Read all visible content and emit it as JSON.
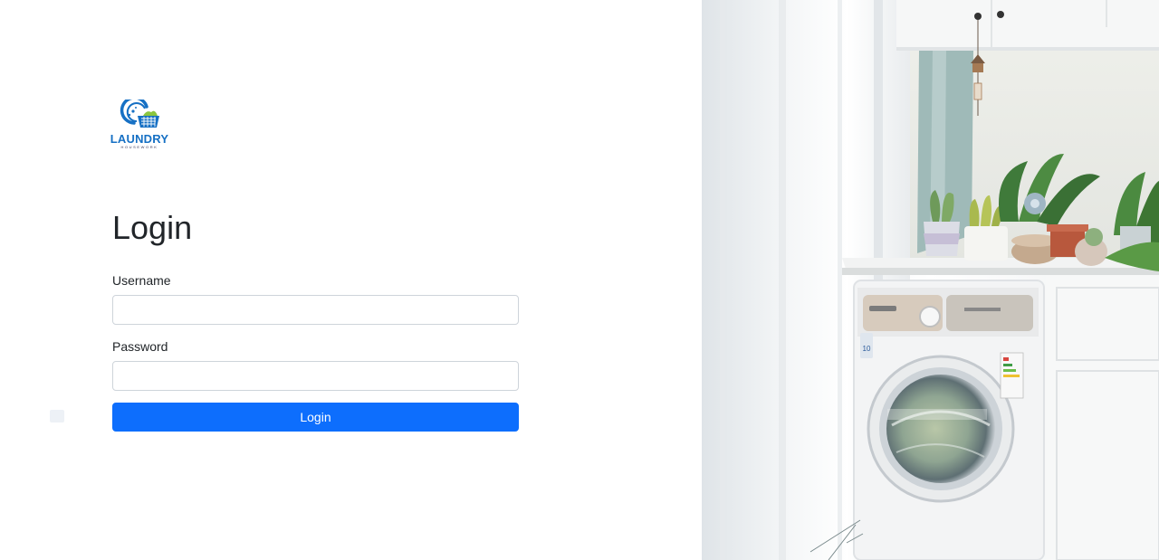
{
  "brand": {
    "name": "LAUNDRY",
    "tagline": "HOUSEWORK",
    "primary_color": "#1670c4",
    "accent_color": "#8cc63f"
  },
  "form": {
    "title": "Login",
    "username_label": "Username",
    "username_value": "",
    "password_label": "Password",
    "password_value": "",
    "submit_label": "Login",
    "button_color": "#0d6efd"
  },
  "hero": {
    "icon": "laundry-room-photo"
  }
}
